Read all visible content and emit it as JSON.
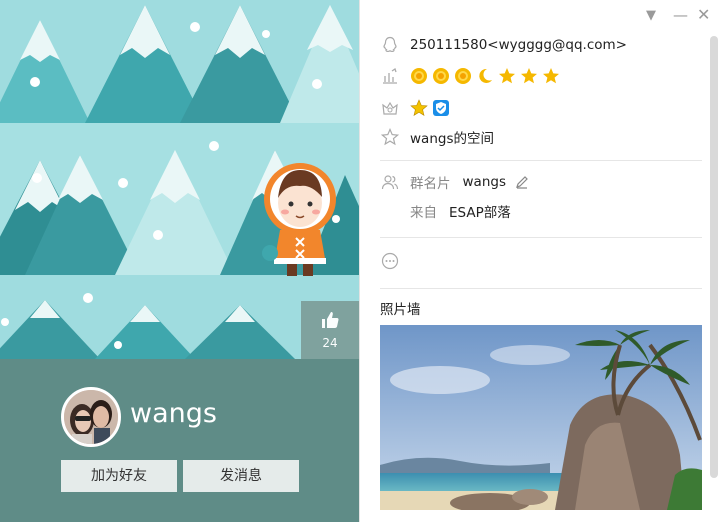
{
  "profile": {
    "nickname": "wangs",
    "likes": "24",
    "add_friend_label": "加为好友",
    "send_message_label": "发消息"
  },
  "info": {
    "qq": "250111580<wygggg@qq.com>",
    "level_icons": [
      "sun",
      "sun",
      "sun",
      "moon",
      "star",
      "star",
      "star"
    ],
    "space_link": "wangs的空间",
    "group_card_label": "群名片",
    "group_card_value": "wangs",
    "from_label": "来自",
    "from_value": "ESAP部落",
    "photo_wall_title": "照片墙"
  },
  "colors": {
    "banner_bg": "#9fdcdf",
    "bottom_bg": "#5f8c87",
    "accent_blue": "#1a8ee8"
  },
  "icons": [
    "penguin-icon",
    "level-icon",
    "badge-icon",
    "star-outline-icon",
    "group-icon",
    "edit-icon",
    "more-icon",
    "like-icon",
    "dropdown-icon",
    "minimize-icon",
    "close-icon"
  ]
}
